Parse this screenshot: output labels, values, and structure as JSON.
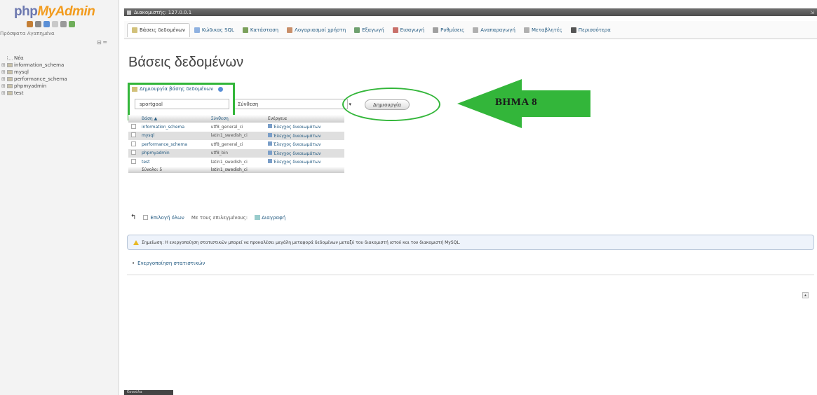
{
  "logo": {
    "php": "php",
    "my": "My",
    "admin": "Admin"
  },
  "nav": {
    "links": "Πρόσφατα  Αγαπημένα",
    "collapse": "⊟ ═",
    "tree": [
      {
        "label": "Νέα",
        "kind": "new"
      },
      {
        "label": "information_schema",
        "kind": "db"
      },
      {
        "label": "mysql",
        "kind": "db"
      },
      {
        "label": "performance_schema",
        "kind": "db"
      },
      {
        "label": "phpmyadmin",
        "kind": "db"
      },
      {
        "label": "test",
        "kind": "db"
      }
    ]
  },
  "serverbar": {
    "text": "Διακομιστής: 127.0.0.1"
  },
  "tabs": [
    {
      "label": "Βάσεις δεδομένων",
      "icon": "database-icon",
      "color": "#d2c17a",
      "active": true
    },
    {
      "label": "Κώδικας SQL",
      "icon": "sql-icon",
      "color": "#8fb1e0",
      "active": false
    },
    {
      "label": "Κατάσταση",
      "icon": "status-icon",
      "color": "#7ba05b",
      "active": false
    },
    {
      "label": "Λογαριασμοί χρήστη",
      "icon": "users-icon",
      "color": "#c98f6a",
      "active": false
    },
    {
      "label": "Εξαγωγή",
      "icon": "export-icon",
      "color": "#6fa06f",
      "active": false
    },
    {
      "label": "Εισαγωγή",
      "icon": "import-icon",
      "color": "#c9706a",
      "active": false
    },
    {
      "label": "Ρυθμίσεις",
      "icon": "wrench-icon",
      "color": "#a0a0a0",
      "active": false
    },
    {
      "label": "Αναπαραγωγή",
      "icon": "replication-icon",
      "color": "#b0b0b0",
      "active": false
    },
    {
      "label": "Μεταβλητές",
      "icon": "variables-icon",
      "color": "#b0b0b0",
      "active": false
    },
    {
      "label": "Περισσότερα",
      "icon": "more-icon",
      "color": "#555555",
      "active": false
    }
  ],
  "page_title": "Βάσεις δεδομένων",
  "create": {
    "label": "Δημιουργία βάσης δεδομένων",
    "db_name_value": "sportgoal",
    "collation_value": "Σύνθεση",
    "button_label": "Δημιουργία"
  },
  "annotation": {
    "step": "ΒΗΜΑ 8",
    "color": "#33b63a"
  },
  "table": {
    "headers": {
      "database": "Βάση ▲",
      "collation": "Σύνθεση",
      "action": "Ενέργεια"
    },
    "rows": [
      {
        "name": "information_schema",
        "collation": "utf8_general_ci",
        "action": "Έλεγχος δικαιωμάτων"
      },
      {
        "name": "mysql",
        "collation": "latin1_swedish_ci",
        "action": "Έλεγχος δικαιωμάτων"
      },
      {
        "name": "performance_schema",
        "collation": "utf8_general_ci",
        "action": "Έλεγχος δικαιωμάτων"
      },
      {
        "name": "phpmyadmin",
        "collation": "utf8_bin",
        "action": "Έλεγχος δικαιωμάτων"
      },
      {
        "name": "test",
        "collation": "latin1_swedish_ci",
        "action": "Έλεγχος δικαιωμάτων"
      }
    ],
    "footer": {
      "total": "Σύνολο: 5",
      "collation": "latin1_swedish_ci"
    }
  },
  "actions": {
    "check_all": "Επιλογή όλων",
    "with_selected": "Με τους επιλεγμένους:",
    "drop": "Διαγραφή"
  },
  "notice": "Σημείωση: Η ενεργοποίηση στατιστικών μπορεί να προκαλέσει μεγάλη μεταφορά δεδομένων μεταξύ του διακομιστή ιστού και του διακομιστή MySQL.",
  "enable_stats": "Ενεργοποίηση στατιστικών",
  "console": "Κονσόλα"
}
